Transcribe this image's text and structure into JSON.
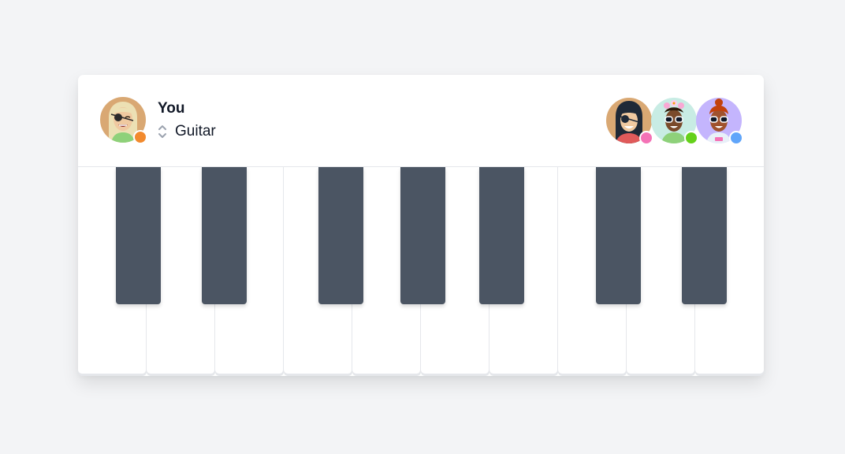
{
  "me": {
    "name": "You",
    "instrument": "Guitar",
    "avatar": "avatar-blonde-eyepatch",
    "status_color": "#f28a2e"
  },
  "peers": [
    {
      "avatar": "avatar-dark-hair-eyepatch",
      "status_color": "#f472b6"
    },
    {
      "avatar": "avatar-flowers-sunglasses",
      "status_color": "#65d11a"
    },
    {
      "avatar": "avatar-red-hair-sunglasses",
      "status_color": "#60a5fa"
    }
  ],
  "keyboard": {
    "white_keys": 10,
    "black_keys": 7,
    "black_key_color": "#4b5563",
    "white_key_color": "#ffffff"
  },
  "icons": {
    "instrument_selector": "chevron-up-down-icon"
  }
}
